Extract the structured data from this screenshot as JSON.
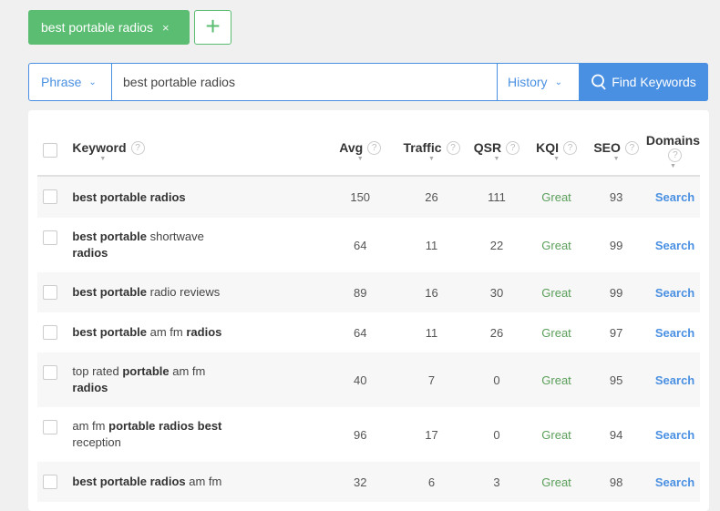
{
  "tag": {
    "label": "best portable radios",
    "close": "×"
  },
  "add_icon": "+",
  "search": {
    "mode": "Phrase",
    "query": "best portable radios",
    "history": "History",
    "find": "Find Keywords"
  },
  "columns": [
    "Keyword",
    "Avg",
    "Traffic",
    "QSR",
    "KQI",
    "SEO",
    "Domains"
  ],
  "help": "?",
  "rows": [
    {
      "kw": [
        {
          "t": "best portable radios",
          "b": true
        }
      ],
      "avg": "150",
      "traffic": "26",
      "qsr": "111",
      "kqi": "Great",
      "seo": "93",
      "domains": "Search"
    },
    {
      "kw": [
        {
          "t": "best portable",
          "b": true
        },
        {
          "t": " shortwave ",
          "b": false
        },
        {
          "t": "radios",
          "b": true
        }
      ],
      "avg": "64",
      "traffic": "11",
      "qsr": "22",
      "kqi": "Great",
      "seo": "99",
      "domains": "Search"
    },
    {
      "kw": [
        {
          "t": "best portable",
          "b": true
        },
        {
          "t": " radio reviews",
          "b": false
        }
      ],
      "avg": "89",
      "traffic": "16",
      "qsr": "30",
      "kqi": "Great",
      "seo": "99",
      "domains": "Search"
    },
    {
      "kw": [
        {
          "t": "best portable",
          "b": true
        },
        {
          "t": " am fm ",
          "b": false
        },
        {
          "t": "radios",
          "b": true
        }
      ],
      "avg": "64",
      "traffic": "11",
      "qsr": "26",
      "kqi": "Great",
      "seo": "97",
      "domains": "Search"
    },
    {
      "kw": [
        {
          "t": "top rated ",
          "b": false
        },
        {
          "t": "portable",
          "b": true
        },
        {
          "t": " am fm ",
          "b": false
        },
        {
          "t": "radios",
          "b": true
        }
      ],
      "avg": "40",
      "traffic": "7",
      "qsr": "0",
      "kqi": "Great",
      "seo": "95",
      "domains": "Search"
    },
    {
      "kw": [
        {
          "t": "am fm ",
          "b": false
        },
        {
          "t": "portable radios best",
          "b": true
        },
        {
          "t": " reception",
          "b": false
        }
      ],
      "avg": "96",
      "traffic": "17",
      "qsr": "0",
      "kqi": "Great",
      "seo": "94",
      "domains": "Search"
    },
    {
      "kw": [
        {
          "t": "best portable radios",
          "b": true
        },
        {
          "t": " am fm",
          "b": false
        }
      ],
      "avg": "32",
      "traffic": "6",
      "qsr": "3",
      "kqi": "Great",
      "seo": "98",
      "domains": "Search"
    }
  ]
}
